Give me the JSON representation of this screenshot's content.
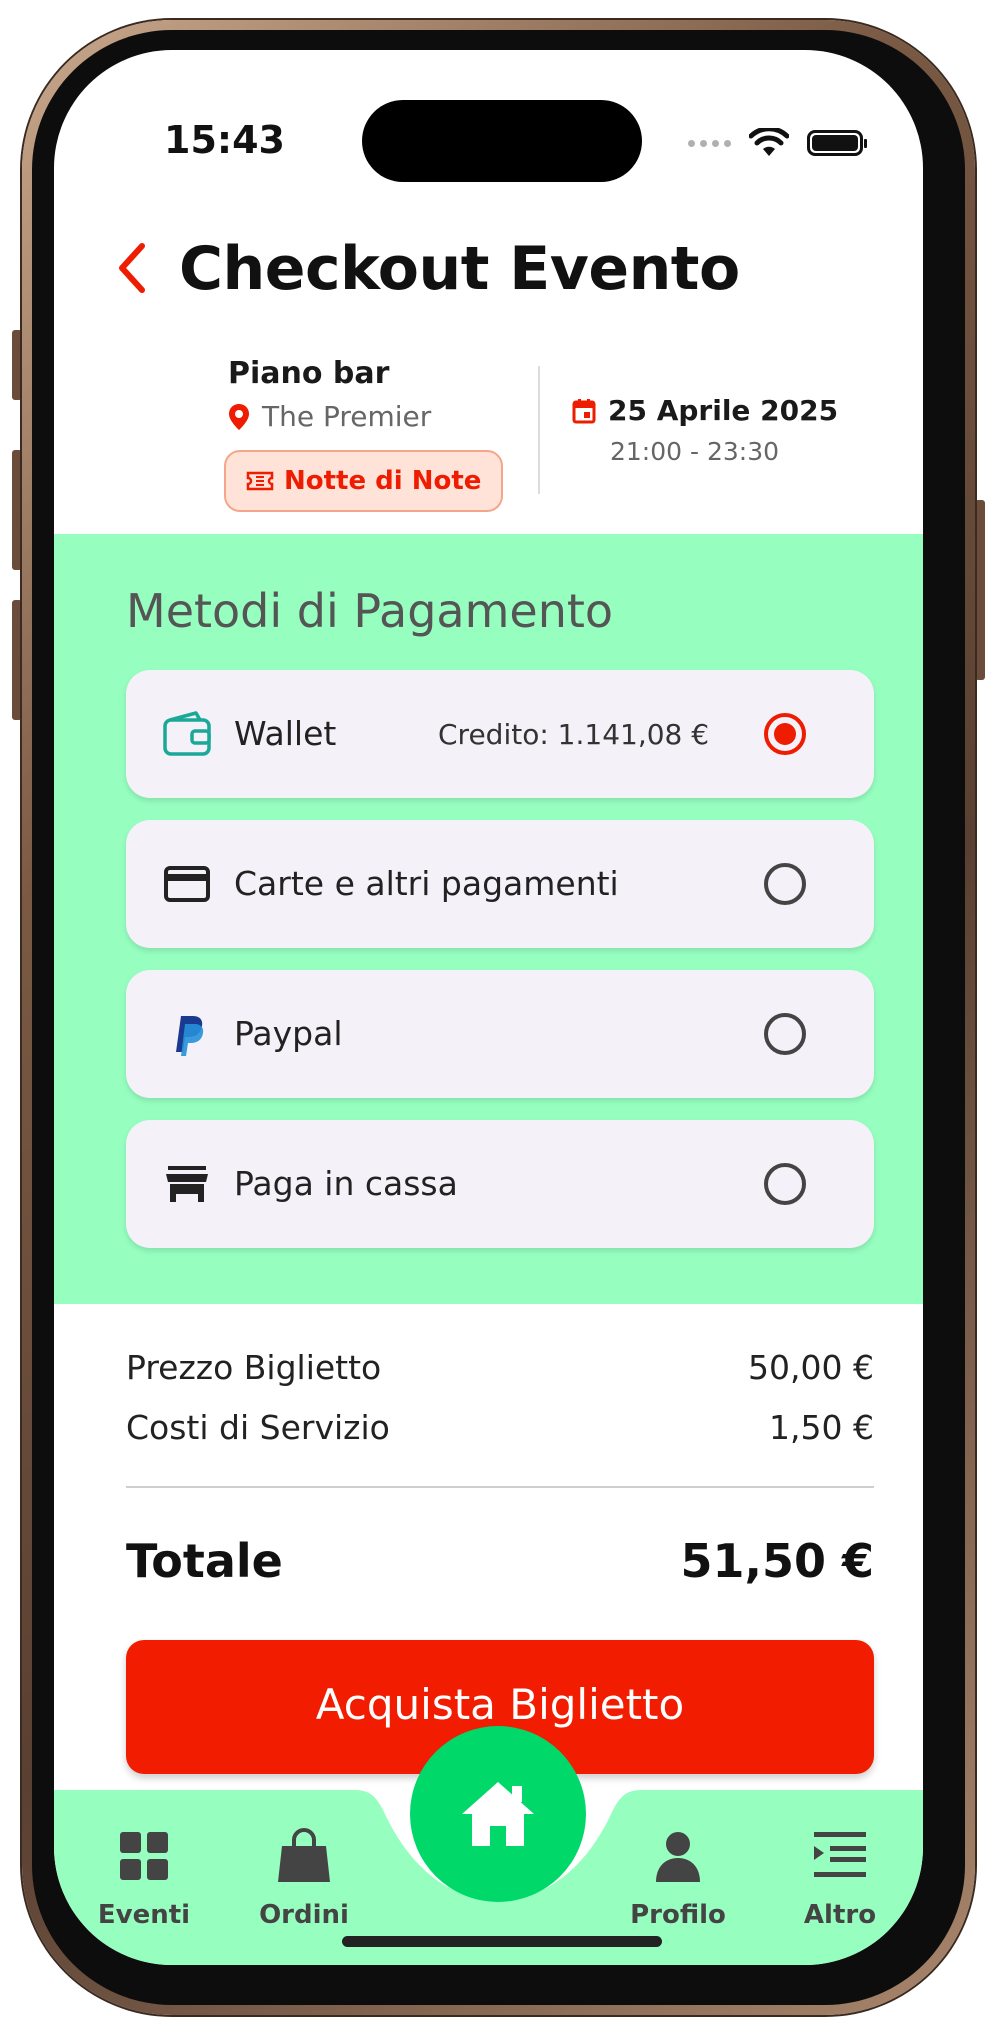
{
  "status_bar": {
    "time": "15:43"
  },
  "header": {
    "title": "Checkout Evento"
  },
  "event": {
    "name": "Piano bar",
    "venue": "The Premier",
    "tag": "Notte di Note",
    "date": "25 Aprile 2025",
    "time": "21:00 - 23:30"
  },
  "payment": {
    "title": "Metodi di Pagamento",
    "methods": [
      {
        "label": "Wallet",
        "extra": "Credito: 1.141,08 €",
        "icon": "wallet-icon",
        "selected": true
      },
      {
        "label": "Carte e altri pagamenti",
        "extra": "",
        "icon": "credit-card-icon",
        "selected": false
      },
      {
        "label": "Paypal",
        "extra": "",
        "icon": "paypal-icon",
        "selected": false
      },
      {
        "label": "Paga in cassa",
        "extra": "",
        "icon": "store-icon",
        "selected": false
      }
    ]
  },
  "summary": {
    "ticket_label": "Prezzo Biglietto",
    "ticket_value": "50,00 €",
    "service_label": "Costi di Servizio",
    "service_value": "1,50 €",
    "total_label": "Totale",
    "total_value": "51,50 €"
  },
  "buy_button": {
    "label": "Acquista Biglietto"
  },
  "nav": {
    "items": [
      {
        "label": "Eventi",
        "icon": "grid-icon"
      },
      {
        "label": "Ordini",
        "icon": "shopping-bag-icon"
      },
      {
        "label": "Profilo",
        "icon": "person-icon"
      },
      {
        "label": "Altro",
        "icon": "menu-icon"
      }
    ],
    "home_icon": "home-icon"
  },
  "colors": {
    "accent": "#ee1c00",
    "mint": "#96ffc0",
    "home_green": "#00d86a",
    "card": "#f5f1f9"
  }
}
